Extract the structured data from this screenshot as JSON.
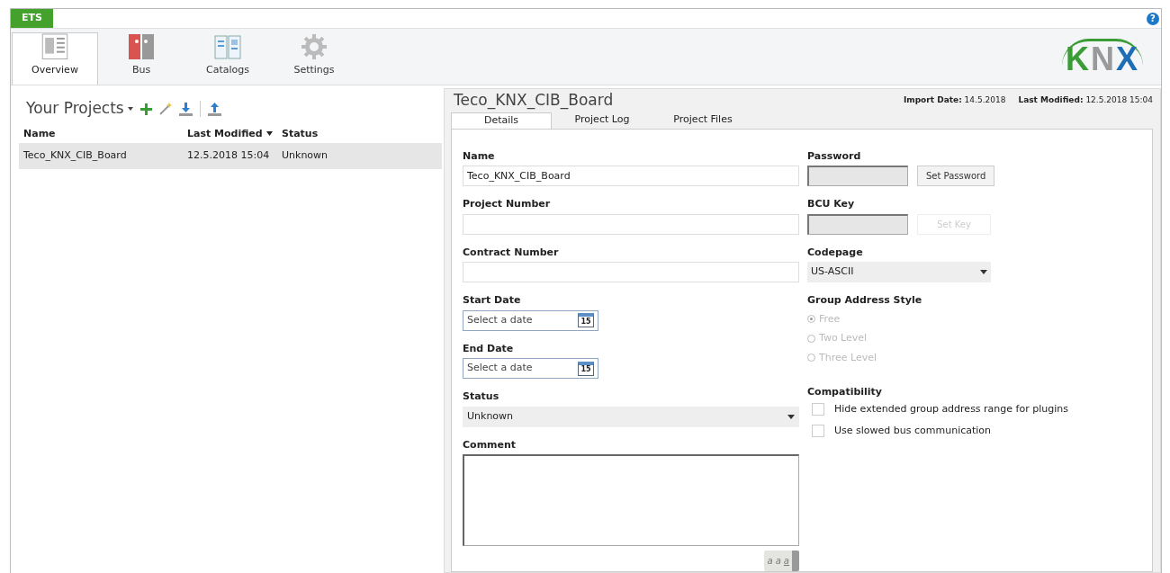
{
  "app_tab": "ETS",
  "help": "?",
  "ribbon_tabs": [
    {
      "label": "Overview",
      "kind": "overview",
      "selected": true
    },
    {
      "label": "Bus",
      "kind": "bus",
      "selected": false
    },
    {
      "label": "Catalogs",
      "kind": "catalog",
      "selected": false
    },
    {
      "label": "Settings",
      "kind": "gear",
      "selected": false
    }
  ],
  "logo": "KNX",
  "projects": {
    "title": "Your Projects",
    "columns": [
      {
        "label": "Name",
        "sorted": false
      },
      {
        "label": "Last Modified",
        "sorted": true
      },
      {
        "label": "Status",
        "sorted": false
      }
    ],
    "rows": [
      {
        "name": "Teco_KNX_CIB_Board",
        "modified": "12.5.2018 15:04",
        "status": "Unknown",
        "selected": true
      }
    ]
  },
  "detail": {
    "title": "Teco_KNX_CIB_Board",
    "import_label": "Import Date:",
    "import_value": "14.5.2018",
    "modified_label": "Last Modified:",
    "modified_value": "12.5.2018 15:04",
    "tabs": [
      {
        "label": "Details",
        "selected": true
      },
      {
        "label": "Project Log",
        "selected": false
      },
      {
        "label": "Project Files",
        "selected": false
      }
    ],
    "left_fields": [
      {
        "kind": "text",
        "label": "Name",
        "value": "Teco_KNX_CIB_Board"
      },
      {
        "kind": "text",
        "label": "Project Number"
      },
      {
        "kind": "text",
        "label": "Contract Number"
      },
      {
        "kind": "date",
        "label": "Start Date",
        "placeholder": "Select a date",
        "calendar": "15"
      },
      {
        "kind": "date",
        "label": "End Date",
        "placeholder": "Select a date",
        "calendar": "15"
      },
      {
        "kind": "select",
        "label": "Status",
        "value": "Unknown"
      },
      {
        "kind": "textarea",
        "label": "Comment",
        "format_buttons": [
          "a",
          "a",
          "a"
        ]
      }
    ],
    "password": {
      "label": "Password",
      "button": "Set Password",
      "disabled": false
    },
    "bcu_key": {
      "label": "BCU Key",
      "button": "Set Key",
      "disabled": true
    },
    "codepage": {
      "label": "Codepage",
      "value": "US-ASCII"
    },
    "group_address_style": {
      "label": "Group Address Style",
      "disabled": true,
      "options": [
        {
          "label": "Free",
          "selected": true
        },
        {
          "label": "Two Level",
          "selected": false
        },
        {
          "label": "Three Level",
          "selected": false
        }
      ]
    },
    "compatibility": {
      "label": "Compatibility",
      "options": [
        {
          "label": "Hide extended group address range for plugins",
          "checked": false
        },
        {
          "label": "Use slowed bus communication",
          "checked": false
        }
      ]
    }
  }
}
